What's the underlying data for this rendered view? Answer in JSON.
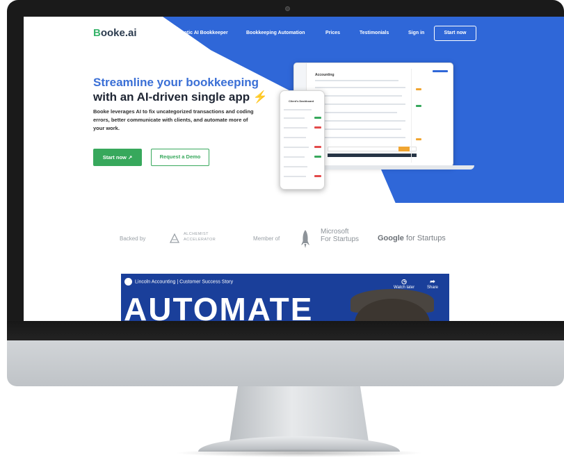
{
  "brand": {
    "prefix": "B",
    "rest": "ooke.ai",
    "accent": "#37b36a",
    "primary_blue": "#2f67d8"
  },
  "nav": {
    "links": [
      "Robotic AI Bookkeeper",
      "Bookkeeping Automation",
      "Prices",
      "Testimonials",
      "Sign in"
    ],
    "cta": "Start now"
  },
  "hero": {
    "title_line1": "Streamline your bookkeeping",
    "title_line2": "with an AI-driven single app",
    "bolt": "⚡",
    "subtitle": "Booke leverages AI to fix uncategorized transactions and coding errors, better communicate with clients, and automate more of your work.",
    "btn_start": "Start now ↗",
    "btn_demo": "Request a Demo"
  },
  "mockup": {
    "laptop_title": "Accounting",
    "phone_title": "Client's Dashboard"
  },
  "backers": {
    "backed_by": "Backed by",
    "alchemist": "ALCHEMIST",
    "accelerator": "ACCELERATOR",
    "member_of": "Member of",
    "microsoft_line1": "Microsoft",
    "microsoft_line2": "For Startups",
    "google": "Google",
    "google_rest": " for Startups"
  },
  "video": {
    "title": "Lincoln Accounting | Customer Success Story",
    "big_text": "AUTOMATE",
    "watch_later": "Watch later",
    "share": "Share"
  }
}
